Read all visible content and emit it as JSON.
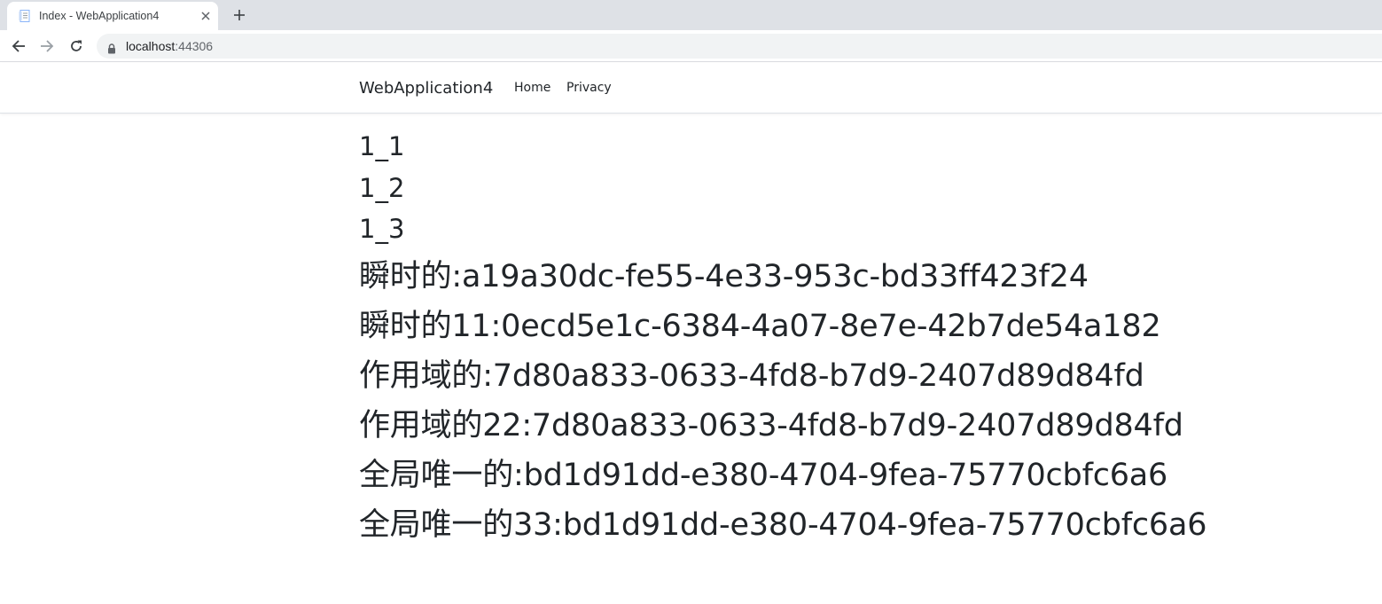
{
  "browser": {
    "tab_title": "Index - WebApplication4",
    "url_host": "localhost",
    "url_port": ":44306"
  },
  "site": {
    "brand": "WebApplication4",
    "nav": [
      {
        "label": "Home"
      },
      {
        "label": "Privacy"
      }
    ]
  },
  "content": {
    "small_lines": [
      "1_1",
      "1_2",
      "1_3"
    ],
    "big_lines": [
      "瞬时的:a19a30dc-fe55-4e33-953c-bd33ff423f24",
      "瞬时的11:0ecd5e1c-6384-4a07-8e7e-42b7de54a182",
      "作用域的:7d80a833-0633-4fd8-b7d9-2407d89d84fd",
      "作用域的22:7d80a833-0633-4fd8-b7d9-2407d89d84fd",
      "全局唯一的:bd1d91dd-e380-4704-9fea-75770cbfc6a6",
      "全局唯一的33:bd1d91dd-e380-4704-9fea-75770cbfc6a6"
    ]
  },
  "colors": {
    "text": "#212529",
    "chrome_tabstrip": "#dee1e6",
    "omnibox": "#f1f3f4"
  }
}
